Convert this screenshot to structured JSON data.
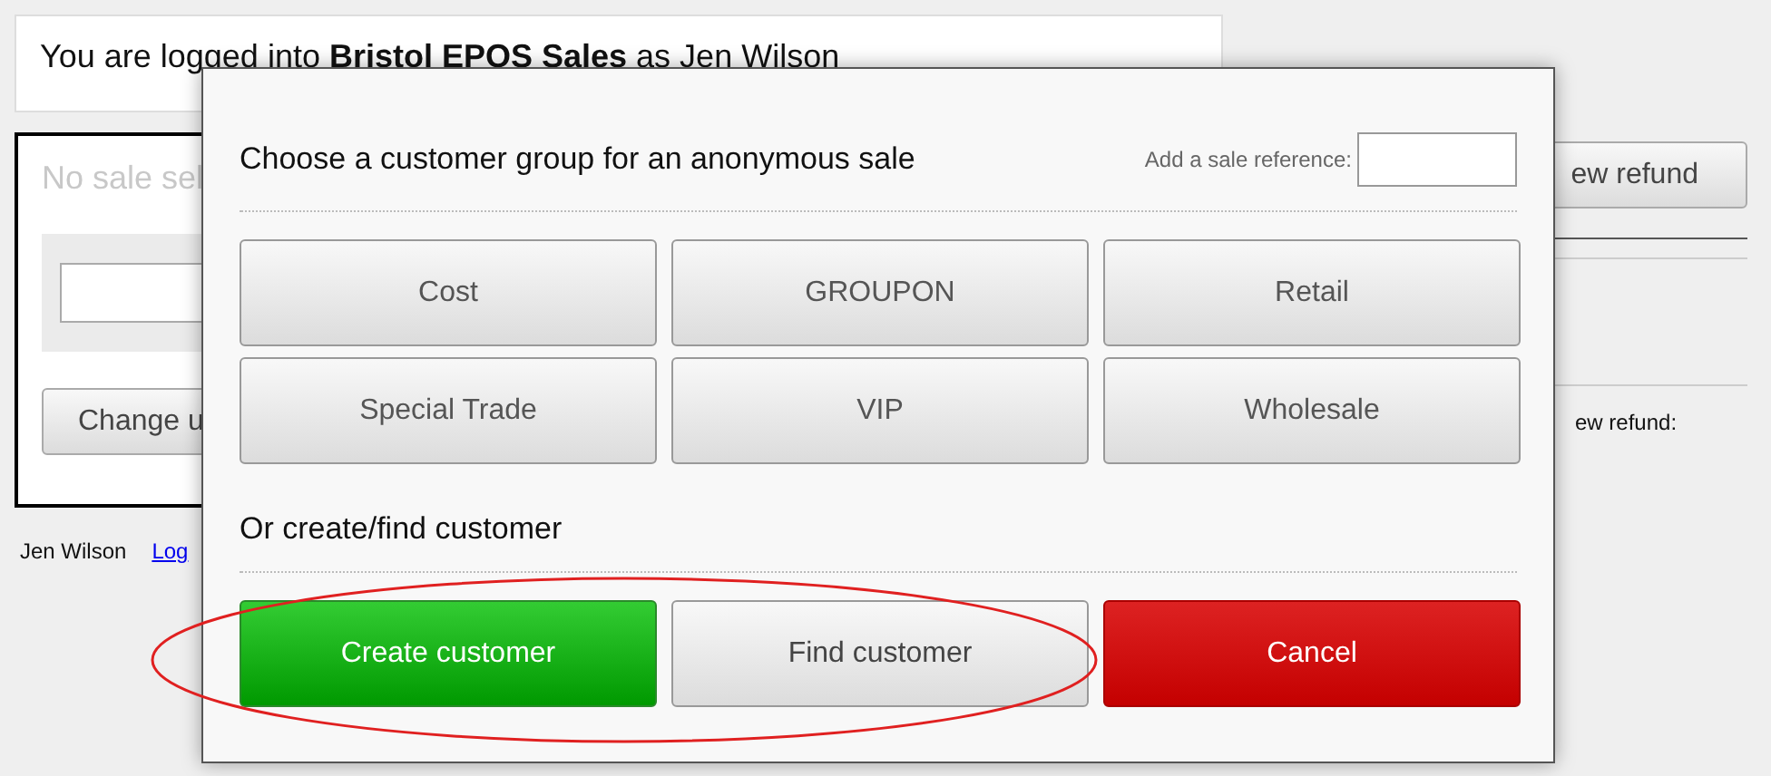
{
  "header": {
    "text": "You are logged into **Bristol EPOS Sales** as Jen Wilson"
  },
  "sale_panel": {
    "status": "No sale sel",
    "button": "Change u"
  },
  "footer": {
    "user": "Jen Wilson",
    "link": "Log"
  },
  "refund_panel": {
    "button": "ew refund",
    "label": "ew refund:"
  },
  "dialog": {
    "title": "Choose a customer group for an anonymous sale",
    "reference": {
      "label": "Add a sale reference:"
    },
    "groups": [
      "Cost",
      "GROUPON",
      "Retail",
      "Special Trade",
      "VIP",
      "Wholesale"
    ],
    "subtitle": "Or create/find customer",
    "actions": [
      {
        "label": "Create customer",
        "kind": "create"
      },
      {
        "label": "Find customer",
        "kind": "find"
      },
      {
        "label": "Cancel",
        "kind": "cancel"
      }
    ],
    "annotation": {
      "kind": "ellipse"
    }
  }
}
